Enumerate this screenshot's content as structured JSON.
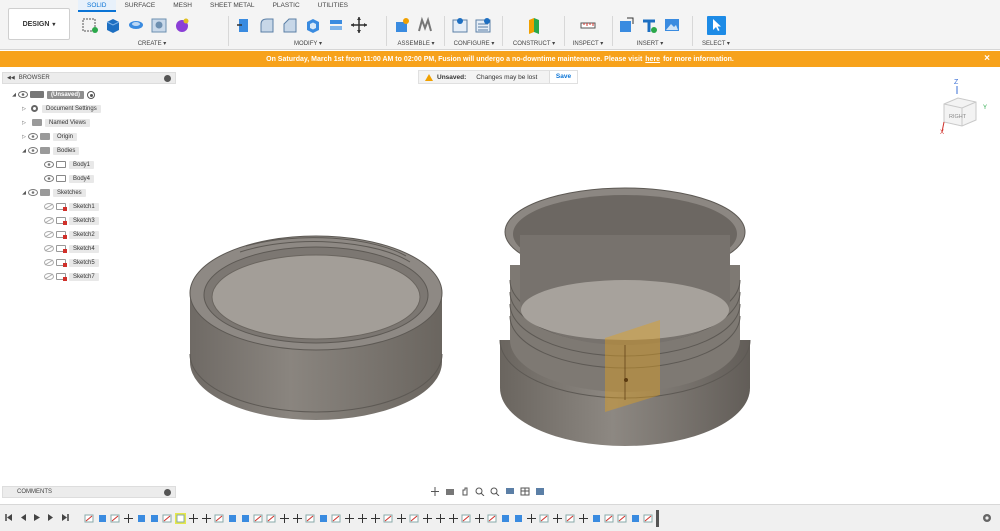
{
  "app": {
    "workspace_label": "DESIGN",
    "tabs": [
      {
        "label": "SOLID",
        "active": true
      },
      {
        "label": "SURFACE"
      },
      {
        "label": "MESH"
      },
      {
        "label": "SHEET METAL"
      },
      {
        "label": "PLASTIC"
      },
      {
        "label": "UTILITIES"
      }
    ],
    "groups": {
      "create": "CREATE ▾",
      "modify": "MODIFY ▾",
      "assemble": "ASSEMBLE ▾",
      "configure": "CONFIGURE ▾",
      "construct": "CONSTRUCT ▾",
      "inspect": "INSPECT ▾",
      "insert": "INSERT ▾",
      "select": "SELECT ▾"
    }
  },
  "banner": {
    "text_before": "On Saturday, March 1st from 11:00 AM to 02:00 PM, Fusion will undergo a no-downtime maintenance. Please visit",
    "link": "here",
    "text_after": "for more information.",
    "close_icon": "close-icon"
  },
  "browser": {
    "title": "BROWSER",
    "root": "(Unsaved)",
    "items": {
      "document_settings": "Document Settings",
      "named_views": "Named Views",
      "origin": "Origin",
      "bodies": "Bodies",
      "body1": "Body1",
      "body4": "Body4",
      "sketches": "Sketches",
      "sketch1": "Sketch1",
      "sketch3": "Sketch3",
      "sketch2": "Sketch2",
      "sketch4": "Sketch4",
      "sketch5": "Sketch5",
      "sketch7": "Sketch7"
    }
  },
  "unsaved": {
    "label": "Unsaved:",
    "message": "Changes may be lost",
    "save": "Save"
  },
  "viewcube": {
    "face": "RIGHT",
    "axis_z": "Z",
    "axis_y": "Y",
    "axis_x": "X"
  },
  "comments": {
    "title": "COMMENTS"
  },
  "colors": {
    "accent": "#0a74d6",
    "banner": "#f7a21b",
    "body": "#7b7670"
  }
}
